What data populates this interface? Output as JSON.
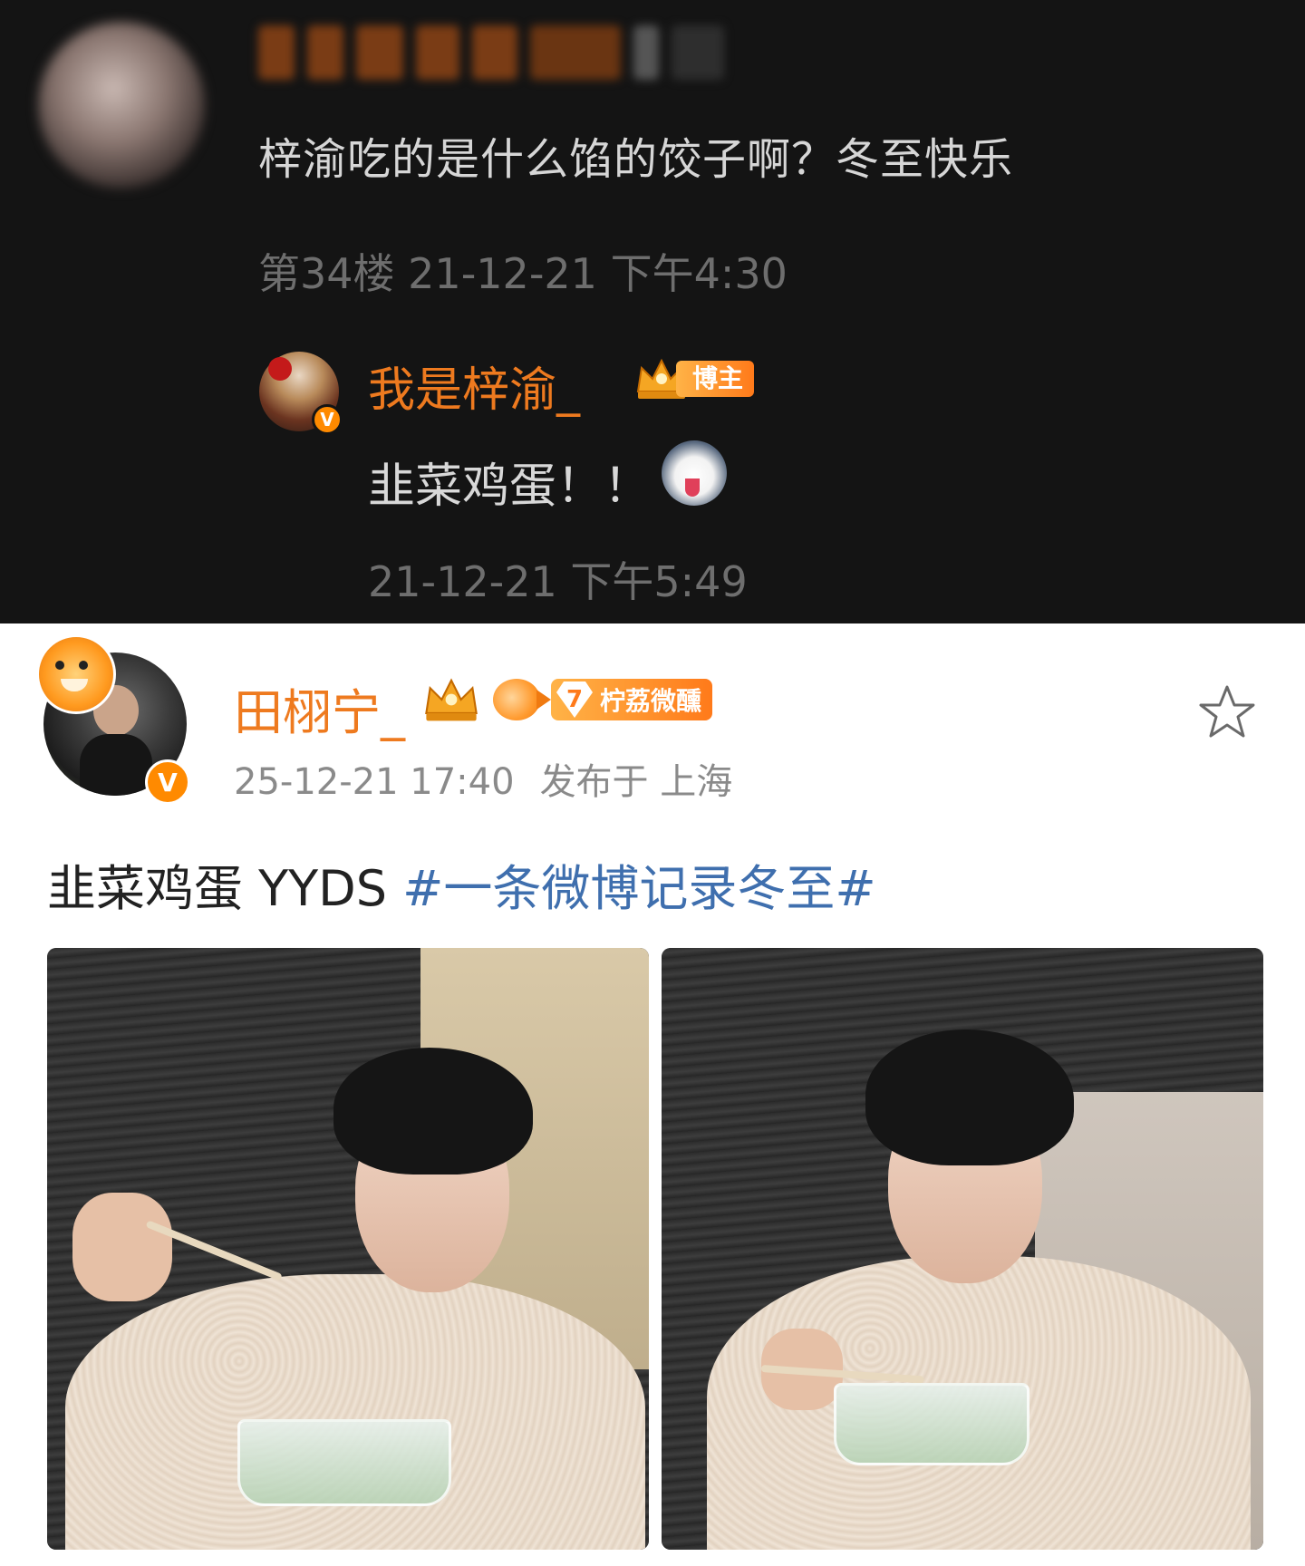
{
  "comment": {
    "text": "梓渝吃的是什么馅的饺子啊？冬至快乐",
    "meta": "第34楼 21-12-21 下午4:30"
  },
  "reply": {
    "username": "我是梓渝_",
    "badge_label": "博主",
    "text": "韭菜鸡蛋！！",
    "time": "21-12-21 下午5:49",
    "verified_mark": "V"
  },
  "post": {
    "username": "田栩宁_",
    "level": "7",
    "fan_badge": "柠荔微醺",
    "time": "25-12-21 17:40",
    "location": "发布于 上海",
    "text": "韭菜鸡蛋 YYDS ",
    "hashtag": "#一条微博记录冬至#",
    "verified_mark": "V",
    "favorite_icon": "star-outline-icon"
  },
  "colors": {
    "username_orange": "#ee7a1f",
    "hashtag_blue": "#3f6fae",
    "dark_bg": "#141414"
  }
}
